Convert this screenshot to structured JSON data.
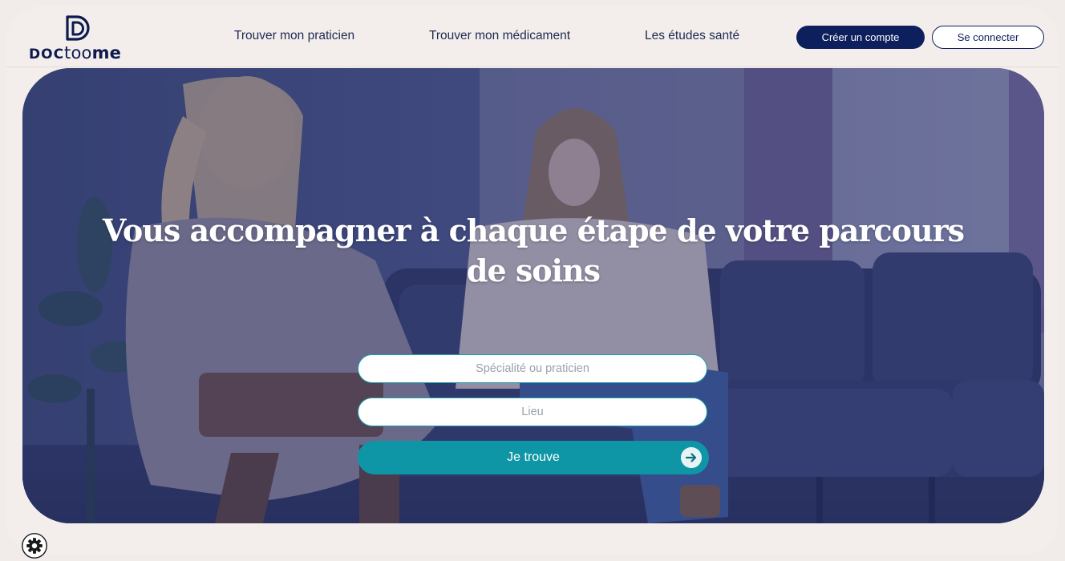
{
  "brand": {
    "logo_part1": "DOC",
    "logo_part2": "too",
    "logo_part3": "me"
  },
  "nav": {
    "items": [
      {
        "label": "Trouver mon praticien"
      },
      {
        "label": "Trouver mon médicament"
      },
      {
        "label": "Les études santé"
      }
    ]
  },
  "auth": {
    "signup_label": "Créer un compte",
    "login_label": "Se connecter"
  },
  "hero": {
    "title": "Vous accompagner à chaque étape de votre parcours de soins"
  },
  "search": {
    "specialite_placeholder": "Spécialité ou praticien",
    "lieu_placeholder": "Lieu",
    "submit_label": "Je trouve"
  },
  "icons": {
    "logo": "doctoome-logo-icon",
    "submit": "arrow-right-icon",
    "settings": "gear-icon"
  },
  "colors": {
    "navy": "#0d1f5c",
    "teal": "#0e96a6",
    "background": "#f3eeeb",
    "overlay": "#3e4878"
  }
}
